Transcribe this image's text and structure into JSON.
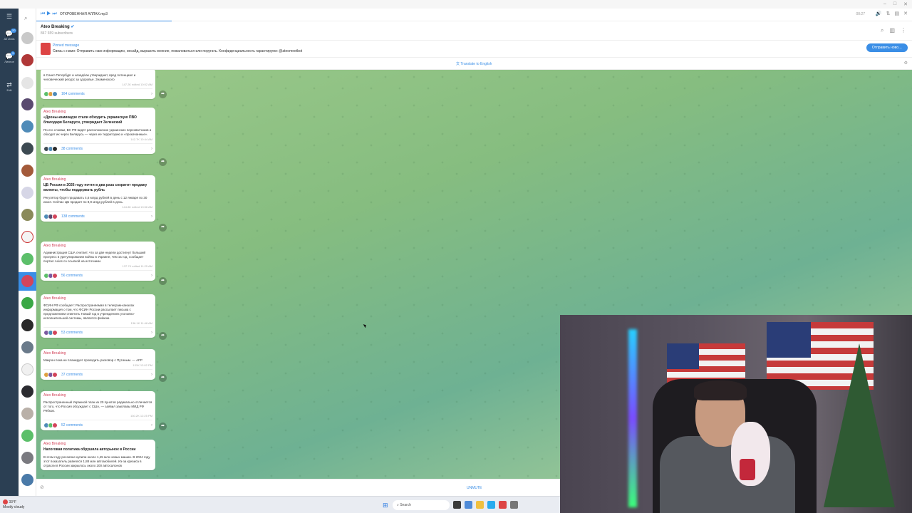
{
  "window": {
    "controls": [
      "–",
      "□",
      "✕"
    ]
  },
  "rail": {
    "all_chats_label": "All chats",
    "all_chats_badge": "20",
    "folder2_label": "Личное",
    "folder2_badge": "3",
    "edit_label": "Edit"
  },
  "media_bar": {
    "track": "ОТКРОВЕННАЯ АЛЛАХ.mp3",
    "time": "00:27"
  },
  "chat": {
    "title": "Ateo Breaking",
    "subscribers": "847 659 subscribers"
  },
  "pinned": {
    "title": "Pinned message",
    "text": "Связь с нами: Отправить нам информацию, инсайд, выразить мнение, пожаловаться или поругать. Конфиденциальность гарантируем: @ateomeetbot",
    "button": "Отправить ново…"
  },
  "translate": {
    "label": "Translate to English"
  },
  "messages": [
    {
      "author": "",
      "headline": "",
      "body": "в Санкт-Петербург и назад/как утверждают, вред потенциал и человеческий ресурс за здоровье. Знаменского",
      "meta": "147.2K edited 10:02 AM",
      "comments": "164 comments"
    },
    {
      "author": "Ateo Breaking",
      "headline": "«Дроны-камикадзе стали обходить украинскую ПВО благодаря Беларуси, утверждает Зеленский",
      "body": "По его словам, ВС РФ видят расположение украинских перехватчиков и обходят их через Беларусь — через ее территорию и «прокачанные».",
      "meta": "142.7K 10:44 AM",
      "comments": "38 comments"
    },
    {
      "author": "Ateo Breaking",
      "headline": "ЦБ России в 2026 году почти в два раза сократит продажу валюты, чтобы поддержать рубль",
      "body": "Регулятор будет продавать 4,6 млрд рублей в день с 12 января по 30 июня. Сейчас ЦБ продает по 8,9 млрд рублей в день.",
      "meta": "144.8K edited 10:56 AM",
      "comments": "138 comments"
    },
    {
      "author": "Ateo Breaking",
      "headline": "",
      "body": "Администрация США считает, что за две недели достигнут больший прогресс в урегулировании войны в Украине, чем за год, сообщает портал Axios со ссылкой на источники.",
      "meta": "137.7K edited 11:25 AM",
      "comments": "56 comments"
    },
    {
      "author": "Ateo Breaking",
      "headline": "",
      "body": "ФСИН РФ сообщает: Распространяемая в телеграм-каналах информация о том, что ФСИН России рассылает письма с предложением отметить Новый год в учреждениях уголовно-исполнительной системы, является фейком.",
      "meta": "136.1K 11:48 AM",
      "comments": "53 comments"
    },
    {
      "author": "Ateo Breaking",
      "headline": "",
      "body": "Макрон пока не планирует проводить разговор с Путиным. — AFP",
      "meta": "131K 12:02 PM",
      "comments": "37 comments"
    },
    {
      "author": "Ateo Breaking",
      "headline": "",
      "body": "Распространенный Украиной план из 20 пунктов радикально отличается от того, что Россия обсуждает с США, — заявил замглавы МИД РФ Рябков.",
      "meta": "130.2K 12:25 PM",
      "comments": "52 comments"
    },
    {
      "author": "Ateo Breaking",
      "headline": "Налоговая политика обрушила авторынок в России",
      "body": "В этом году россияне купили около 1,45 млн новых машин. В 2024 году этот показатель равнялся 1,88 млн автомобилей. Из-за кризиса в отрасли в России закрылось около 200 автосалонов",
      "meta": "",
      "comments": ""
    }
  ],
  "bottom": {
    "unmute": "UNMUTE"
  },
  "taskbar": {
    "temp": "33°F",
    "weather": "Mostly cloudy",
    "search": "Search"
  },
  "icons": {
    "forward": "forward-icon",
    "attach": "paperclip-icon",
    "search": "search-icon",
    "menu": "hamburger-icon"
  },
  "colors": {
    "accent": "#3a8ee6",
    "author": "#d3455b",
    "rail": "#2b3f53"
  }
}
